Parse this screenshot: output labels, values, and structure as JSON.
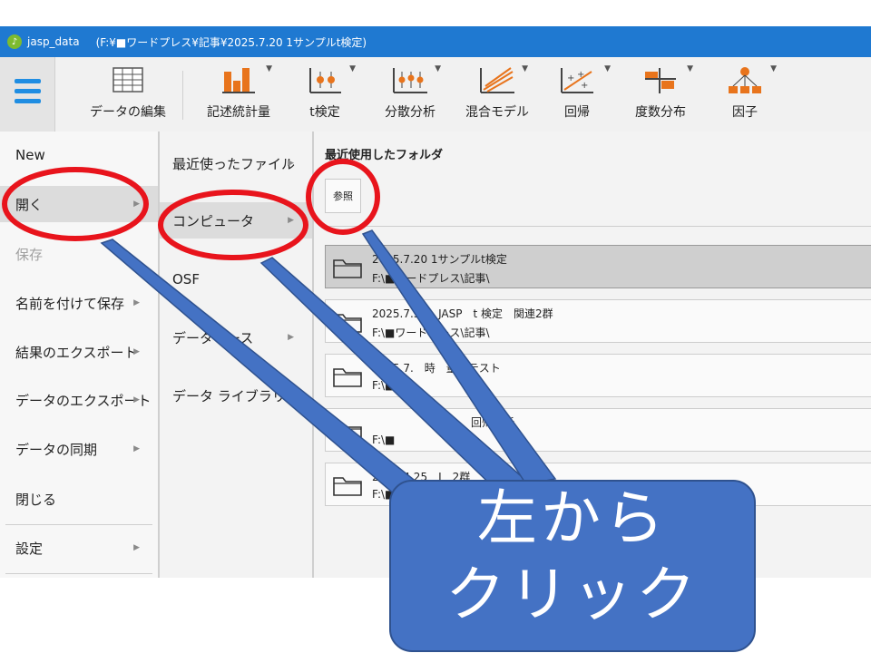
{
  "window": {
    "app_name": "jasp_data",
    "path": "(F:¥■ワードプレス¥記事¥2025.7.20 1サンプルt検定)"
  },
  "toolbar": {
    "items": [
      {
        "label": "データの編集",
        "icon": "table-icon"
      },
      {
        "label": "記述統計量",
        "icon": "bar-chart-icon"
      },
      {
        "label": "t検定",
        "icon": "ttest-icon"
      },
      {
        "label": "分散分析",
        "icon": "anova-icon"
      },
      {
        "label": "混合モデル",
        "icon": "mixed-model-icon"
      },
      {
        "label": "回帰",
        "icon": "regression-icon"
      },
      {
        "label": "度数分布",
        "icon": "frequencies-icon"
      },
      {
        "label": "因子",
        "icon": "factor-icon"
      }
    ]
  },
  "file_menu": {
    "items": [
      {
        "label": "New",
        "has_submenu": false
      },
      {
        "label": "開く",
        "has_submenu": true,
        "active": true
      },
      {
        "label": "保存",
        "has_submenu": false,
        "disabled": true
      },
      {
        "label": "名前を付けて保存",
        "has_submenu": true
      },
      {
        "label": "結果のエクスポート",
        "has_submenu": true
      },
      {
        "label": "データのエクスポート",
        "has_submenu": true
      },
      {
        "label": "データの同期",
        "has_submenu": true
      },
      {
        "label": "閉じる",
        "has_submenu": false
      },
      {
        "label": "設定",
        "has_submenu": true
      }
    ]
  },
  "open_menu": {
    "items": [
      {
        "label": "最近使ったファイル",
        "active": false
      },
      {
        "label": "コンピュータ",
        "active": true
      },
      {
        "label": "OSF",
        "active": false
      },
      {
        "label": "データベース",
        "active": false
      },
      {
        "label": "データ ライブラリ",
        "active": false
      }
    ]
  },
  "recent_folders": {
    "title": "最近使用したフォルダ",
    "browse_label": "参照",
    "items": [
      {
        "name": "2025.7.20 1サンプルt検定",
        "path": "F:\\■ワードプレス\\記事\\",
        "selected": true
      },
      {
        "name": "2025.7.30　JASP　t 検定　関連2群",
        "path": "F:\\■ワードプレス\\記事\\"
      },
      {
        "name": "2025.7.　時　量　テスト",
        "path": "F:\\■"
      },
      {
        "name": "回帰分析",
        "path": "F:\\■"
      },
      {
        "name": "2025.4.25　J　2群",
        "path": "F:\\■"
      }
    ]
  },
  "annotation": {
    "callout_text": "左から\nクリック",
    "highlight_color": "#e8141c",
    "callout_color": "#4472c4",
    "callout_border": "#2f528f"
  },
  "colors": {
    "titlebar": "#1f79d1",
    "accent": "#1f8de2"
  }
}
